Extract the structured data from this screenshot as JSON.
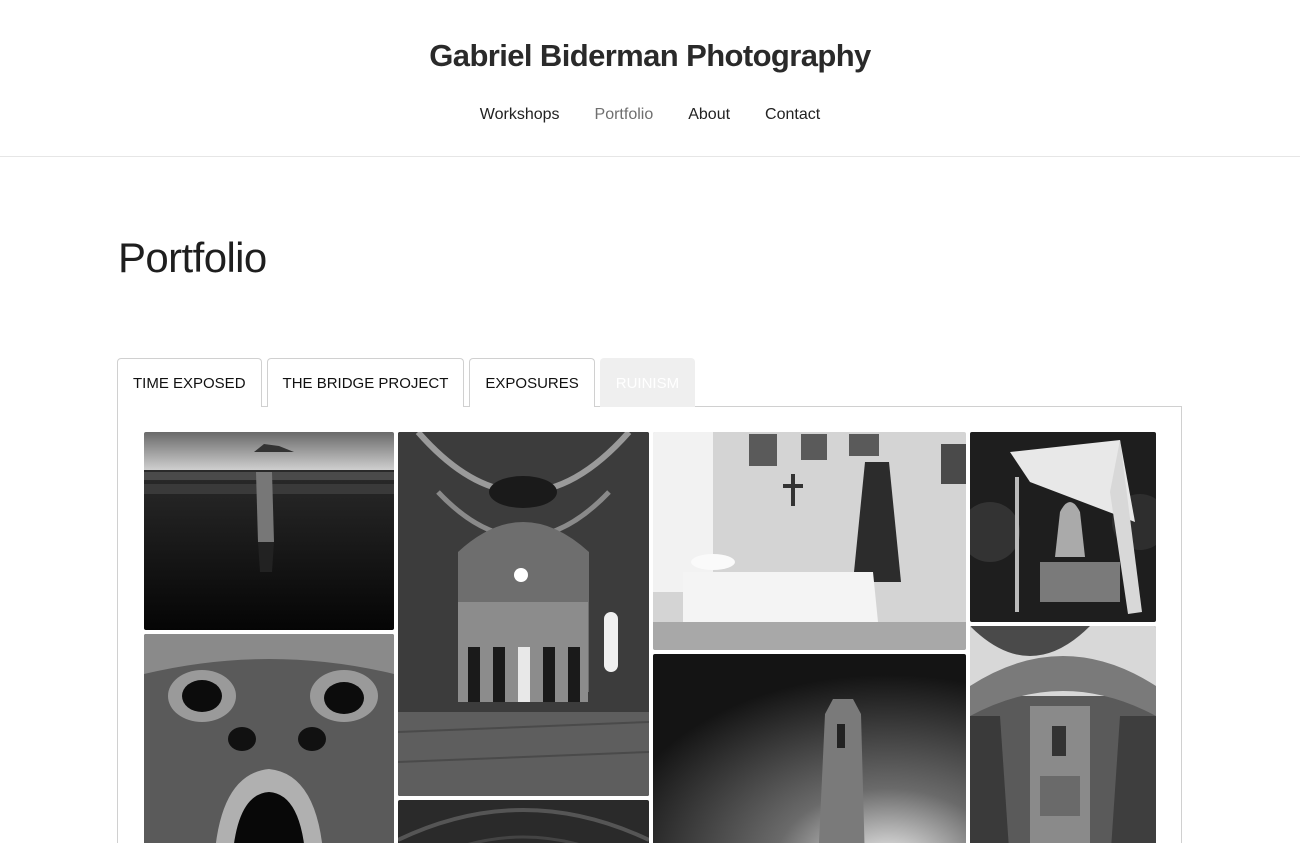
{
  "site": {
    "title": "Gabriel Biderman Photography"
  },
  "nav": {
    "items": [
      "Workshops",
      "Portfolio",
      "About",
      "Contact"
    ],
    "active": "Portfolio"
  },
  "page": {
    "title": "Portfolio"
  },
  "tabs": {
    "items": [
      "TIME EXPOSED",
      "THE BRIDGE PROJECT",
      "EXPOSURES",
      "RUINISM"
    ],
    "active": "RUINISM"
  },
  "colors": {
    "tab_active_bg": "#efefef",
    "border": "#d0d0d0",
    "nav_active": "#6f6f6f"
  }
}
